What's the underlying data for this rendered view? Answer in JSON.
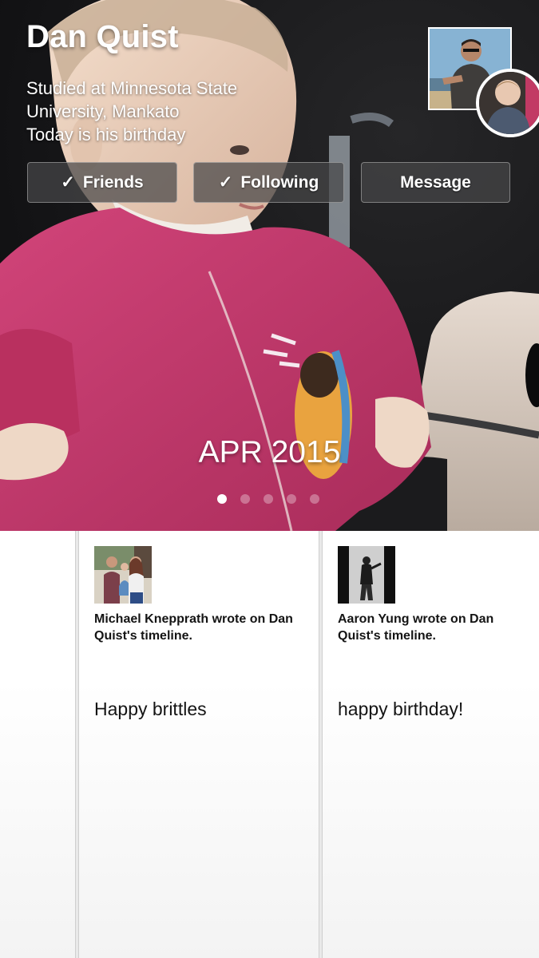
{
  "profile": {
    "name": "Dan Quist",
    "info_lines": [
      "Studied at Minnesota State",
      "University, Mankato",
      "Today is his birthday"
    ]
  },
  "actions": {
    "friends_label": "Friends",
    "following_label": "Following",
    "message_label": "Message",
    "check_glyph": "✓"
  },
  "cover": {
    "date_label": "APR 2015",
    "pages": 5,
    "active_page": 0
  },
  "feed": {
    "posts": [
      {
        "header": "Michael Knepprath wrote on Dan Quist's timeline.",
        "body": "Happy brittles"
      },
      {
        "header": "Aaron Yung wrote on Dan Quist's timeline.",
        "body": "happy birthday!"
      }
    ]
  },
  "colors": {
    "sweater": "#c4356b",
    "button_bg": "#464648",
    "card_bg": "#ffffff",
    "text_dark": "#141414"
  }
}
